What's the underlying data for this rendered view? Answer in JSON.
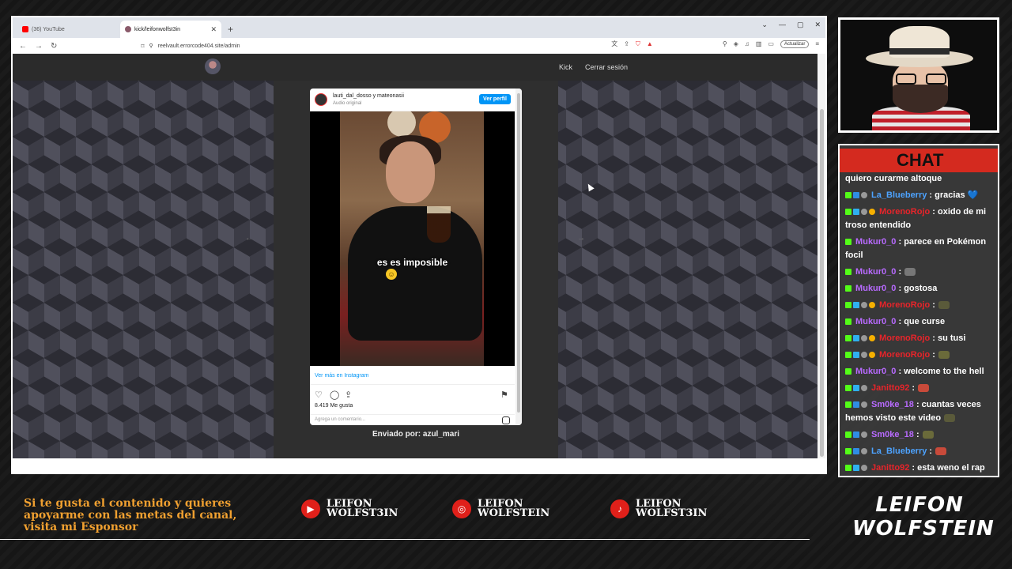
{
  "browser": {
    "tabs": [
      {
        "label": "(36) YouTube",
        "active": false,
        "favicon_color": "#ff0000"
      },
      {
        "label": "kick/leifonwolfst3in",
        "active": true,
        "favicon_color": "#8a5a6a"
      }
    ],
    "new_tab": "+",
    "url": "reelvault.errorcode404.site/admin",
    "update_button": "Actualizar"
  },
  "site": {
    "nav": [
      "Kick",
      "Cerrar sesión"
    ],
    "sent_by": "Enviado por: azul_mari"
  },
  "instagram": {
    "user": "lauti_dal_dosso y mateonasii",
    "subtitle": "Audio original",
    "follow_label": "Ver perfil",
    "video_caption": "es es imposible",
    "more_link": "Ver más en Instagram",
    "likes": "8.419 Me gusta",
    "comment_placeholder": "Agrega un comentario..."
  },
  "chat": {
    "title": "CHAT",
    "messages": [
      {
        "user": "",
        "text": "quiero curarme altoque",
        "color": "#ffffff",
        "badges": []
      },
      {
        "user": "La_Blueberry",
        "text": ": gracias 💙",
        "color": "#4da3ff",
        "badges": [
          "b-k",
          "b-blue",
          "b-gray"
        ]
      },
      {
        "user": "MorenoRojo",
        "text": ": oxido de mi troso entendido",
        "color": "#e8242a",
        "badges": [
          "b-k",
          "b-sub",
          "b-gray",
          "b-gold"
        ]
      },
      {
        "user": "Mukur0_0",
        "text": ": parece en Pokémon focil",
        "color": "#b86aff",
        "badges": [
          "b-k"
        ]
      },
      {
        "user": "Mukur0_0",
        "text": ":",
        "color": "#b86aff",
        "badges": [
          "b-k"
        ],
        "emote": "#777777"
      },
      {
        "user": "Mukur0_0",
        "text": ": gostosa",
        "color": "#b86aff",
        "badges": [
          "b-k"
        ]
      },
      {
        "user": "MorenoRojo",
        "text": ":",
        "color": "#e8242a",
        "badges": [
          "b-k",
          "b-sub",
          "b-gray",
          "b-gold"
        ],
        "emote": "#5a5a3a"
      },
      {
        "user": "Mukur0_0",
        "text": ": que curse",
        "color": "#b86aff",
        "badges": [
          "b-k"
        ]
      },
      {
        "user": "MorenoRojo",
        "text": ": su tusi",
        "color": "#e8242a",
        "badges": [
          "b-k",
          "b-sub",
          "b-gray",
          "b-gold"
        ]
      },
      {
        "user": "MorenoRojo",
        "text": ":",
        "color": "#e8242a",
        "badges": [
          "b-k",
          "b-sub",
          "b-gray",
          "b-gold"
        ],
        "emote": "#6a6a3a"
      },
      {
        "user": "Mukur0_0",
        "text": ": welcome to the hell",
        "color": "#b86aff",
        "badges": [
          "b-k"
        ]
      },
      {
        "user": "Janitto92",
        "text": ":",
        "color": "#e8242a",
        "badges": [
          "b-k",
          "b-sub",
          "b-gray"
        ],
        "emote": "#c84a3a"
      },
      {
        "user": "Sm0ke_18",
        "text": ": cuantas veces hemos visto este video",
        "color": "#b86aff",
        "badges": [
          "b-k",
          "b-blue",
          "b-gray"
        ],
        "emote": "#5a5a3a"
      },
      {
        "user": "Sm0ke_18",
        "text": ":",
        "color": "#b86aff",
        "badges": [
          "b-k",
          "b-blue",
          "b-gray"
        ],
        "emote": "#6a6a3a"
      },
      {
        "user": "La_Blueberry",
        "text": ":",
        "color": "#4da3ff",
        "badges": [
          "b-k",
          "b-blue",
          "b-gray"
        ],
        "emote": "#c84a3a"
      },
      {
        "user": "Janitto92",
        "text": ": esta weno el rap",
        "color": "#e8242a",
        "badges": [
          "b-k",
          "b-sub",
          "b-gray"
        ]
      }
    ]
  },
  "overlay": {
    "promo_text": "Si te gusta el contenido y quieres apoyarme con las metas del canal, visita mi Esponsor",
    "socials": [
      {
        "icon": "youtube-icon",
        "line1": "LEIFON",
        "line2": "WOLFST3IN"
      },
      {
        "icon": "instagram-icon",
        "line1": "LEIFON",
        "line2": "WOLFSTEIN"
      },
      {
        "icon": "tiktok-icon",
        "line1": "LEIFON",
        "line2": "WOLFST3IN"
      }
    ],
    "brand_line1": "LEIFON",
    "brand_line2": "WOLFSTEIN"
  }
}
